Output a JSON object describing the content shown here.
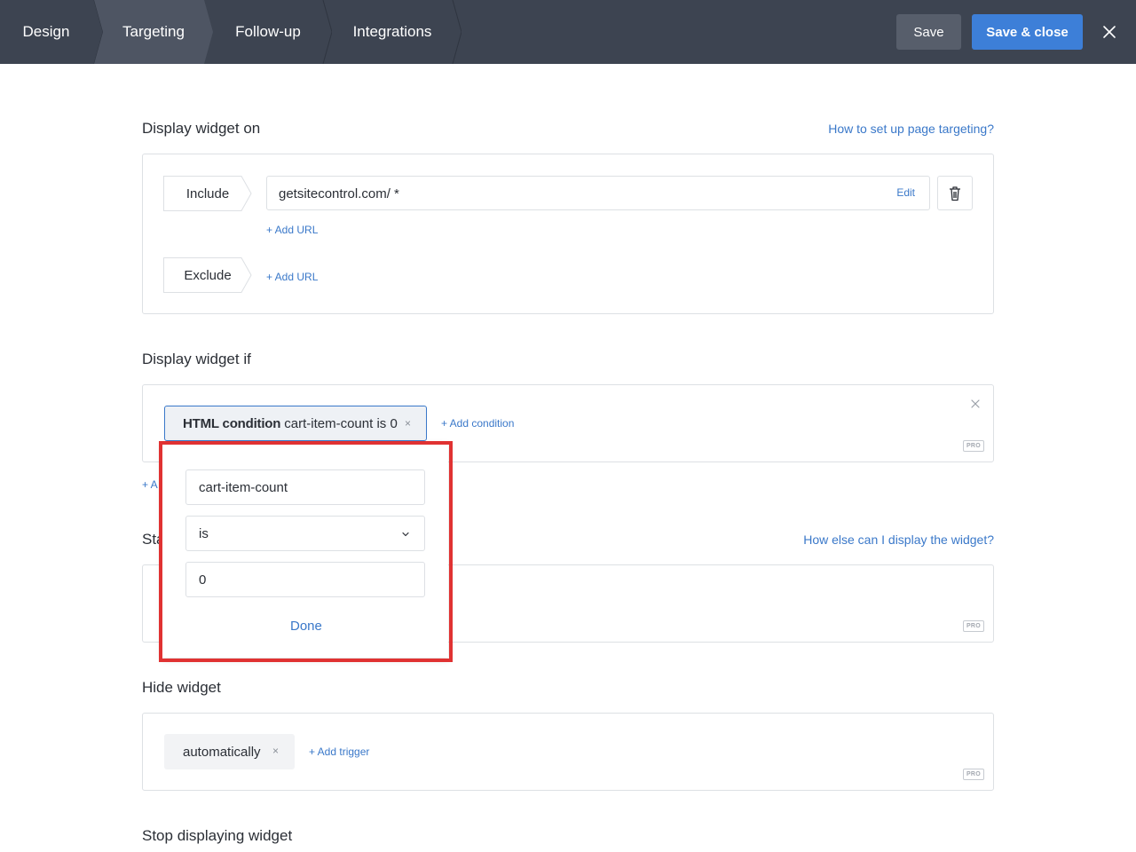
{
  "topbar": {
    "tabs": [
      {
        "label": "Design"
      },
      {
        "label": "Targeting"
      },
      {
        "label": "Follow-up"
      },
      {
        "label": "Integrations"
      }
    ],
    "save_label": "Save",
    "save_close_label": "Save & close",
    "close_icon": "close-icon",
    "accent_color": "#3d7fd8",
    "bar_color": "#3d4451"
  },
  "display_on": {
    "title": "Display widget on",
    "help_link": "How to set up page targeting?",
    "include_label": "Include",
    "include_url": "getsitecontrol.com/ *",
    "edit_label": "Edit",
    "add_url_label": "+ Add URL",
    "exclude_label": "Exclude",
    "exclude_add_url_label": "+ Add URL",
    "trash_icon": "trash-icon"
  },
  "display_if": {
    "title": "Display widget if",
    "condition_bold": "HTML condition",
    "condition_text": "cart-item-count is 0",
    "condition_remove": "×",
    "add_condition_label": "+ Add condition",
    "pro_badge": "PRO",
    "behind_link_fragment": "+ A"
  },
  "start_section": {
    "title_fragment": "Sta",
    "help_link": "How else can I display the widget?",
    "pro_badge": "PRO"
  },
  "hide_widget": {
    "title": "Hide widget",
    "chip_label": "automatically",
    "chip_remove": "×",
    "add_trigger_label": "+ Add trigger",
    "pro_badge": "PRO"
  },
  "stop_displaying": {
    "title": "Stop displaying widget"
  },
  "popover": {
    "field_name": "cart-item-count",
    "operator": "is",
    "value": "0",
    "done_label": "Done",
    "highlight_color": "#e03232"
  }
}
